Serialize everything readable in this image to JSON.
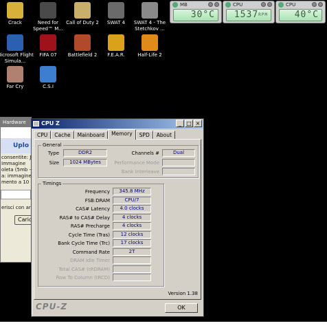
{
  "desktop": {
    "icons": [
      {
        "label": "Crack",
        "color": "#d7b13b"
      },
      {
        "label": "Need for Speed™ M...",
        "color": "#4a4a4a"
      },
      {
        "label": "Call of Duty 2",
        "color": "#c9b06a"
      },
      {
        "label": "SWAT 4",
        "color": "#6a6a6a"
      },
      {
        "label": "SWAT 4 - The Stetchkov ...",
        "color": "#8a8a8a"
      },
      {
        "label": "Microsoft Flight Simula...",
        "color": "#2b5fb0"
      },
      {
        "label": "FIFA 07",
        "color": "#a0121b"
      },
      {
        "label": "Battlefield 2",
        "color": "#b04a2a"
      },
      {
        "label": "F.E.A.R.",
        "color": "#d9a21a"
      },
      {
        "label": "Half-Life 2",
        "color": "#e08a1a"
      },
      {
        "label": "Far Cry",
        "color": "#b08070"
      },
      {
        "label": "C.S.I",
        "color": "#3e7ed0"
      }
    ]
  },
  "gadgets": [
    {
      "label": "MB",
      "value": "30°C",
      "unit": ""
    },
    {
      "label": "CPU",
      "value": "1537",
      "unit": "RPM"
    },
    {
      "label": "CPU",
      "value": "40°C",
      "unit": ""
    }
  ],
  "bg_window": {
    "title": "Hardware",
    "heading": "Uplo",
    "lines": [
      "consentite: J",
      "Immagine",
      "oleta (5mb -",
      "a: immagine",
      "mento a 10"
    ],
    "input_text": "erisci con ar",
    "button_label": "Caric"
  },
  "cpuz": {
    "title": "CPU Z",
    "tabs": [
      "CPU",
      "Cache",
      "Mainboard",
      "Memory",
      "SPD",
      "About"
    ],
    "active_tab": "Memory",
    "general": {
      "group_title": "General",
      "type_label": "Type",
      "type_value": "DDR2",
      "size_label": "Size",
      "size_value": "1024 MBytes",
      "channels_label": "Channels #",
      "channels_value": "Dual",
      "perf_mode_label": "Performance Mode",
      "bank_interleave_label": "Bank Interleave"
    },
    "timings": {
      "group_title": "Timings",
      "rows": [
        {
          "label": "Frequency",
          "value": "345.8 MHz",
          "enabled": true
        },
        {
          "label": "FSB:DRAM",
          "value": "CPU/7",
          "enabled": true
        },
        {
          "label": "CAS# Latency",
          "value": "4.0 clocks",
          "enabled": true
        },
        {
          "label": "RAS# to CAS# Delay",
          "value": "4 clocks",
          "enabled": true
        },
        {
          "label": "RAS# Precharge",
          "value": "4 clocks",
          "enabled": true
        },
        {
          "label": "Cycle Time (Tras)",
          "value": "12 clocks",
          "enabled": true
        },
        {
          "label": "Bank Cycle Time (Trc)",
          "value": "17 clocks",
          "enabled": true
        },
        {
          "label": "Command Rate",
          "value": "2T",
          "enabled": true
        },
        {
          "label": "DRAM Idle Timer",
          "value": "",
          "enabled": false
        },
        {
          "label": "Total CAS# (tRDRAM)",
          "value": "",
          "enabled": false
        },
        {
          "label": "Row To Column (tRCD)",
          "value": "",
          "enabled": false
        }
      ]
    },
    "version": "Version 1.38",
    "logo": "CPU-Z",
    "ok_label": "OK"
  }
}
